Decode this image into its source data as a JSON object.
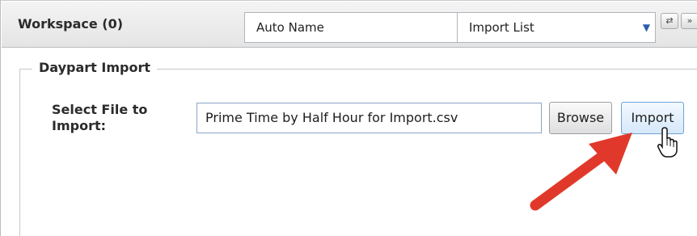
{
  "workspace": {
    "title": "Workspace (0)",
    "auto_name": "Auto Name",
    "import_list": "Import List",
    "dropdown_icon": "chevron-down-icon",
    "refresh_icon": "refresh-icon",
    "expand_icon": "double-chevron-right-icon",
    "refresh_glyph": "⇄",
    "expand_glyph": "»"
  },
  "daypart_import": {
    "legend": "Daypart Import",
    "file_label": "Select File to Import:",
    "file_value": "Prime Time by Half Hour for Import.csv",
    "browse_label": "Browse",
    "import_label": "Import"
  },
  "annotation": {
    "arrow_color": "#e0392b",
    "cursor_icon": "hand-pointer-icon"
  }
}
